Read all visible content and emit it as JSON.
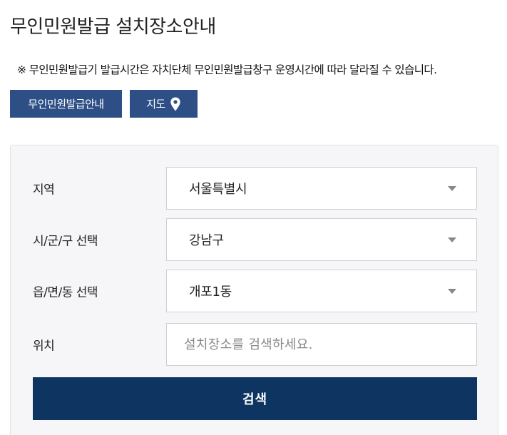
{
  "page": {
    "title": "무인민원발급 설치장소안내",
    "notice": "※ 무인민원발급기 발급시간은 자치단체 무인민원발급창구 운영시간에 따라 달라질 수 있습니다."
  },
  "buttons": {
    "guide_label": "무인민원발급안내",
    "map_label": "지도",
    "map_icon": "map-pin-icon"
  },
  "form": {
    "region": {
      "label": "지역",
      "value": "서울특별시"
    },
    "district": {
      "label": "시/군/구 선택",
      "value": "강남구"
    },
    "town": {
      "label": "읍/면/동 선택",
      "value": "개포1동"
    },
    "location": {
      "label": "위치",
      "placeholder": "설치장소를 검색하세요.",
      "value": ""
    },
    "search_label": "검색"
  },
  "colors": {
    "tab_button": "#2d4f86",
    "search_button": "#0e3561",
    "panel_bg": "#f6f6f8",
    "caret": "#888888"
  }
}
